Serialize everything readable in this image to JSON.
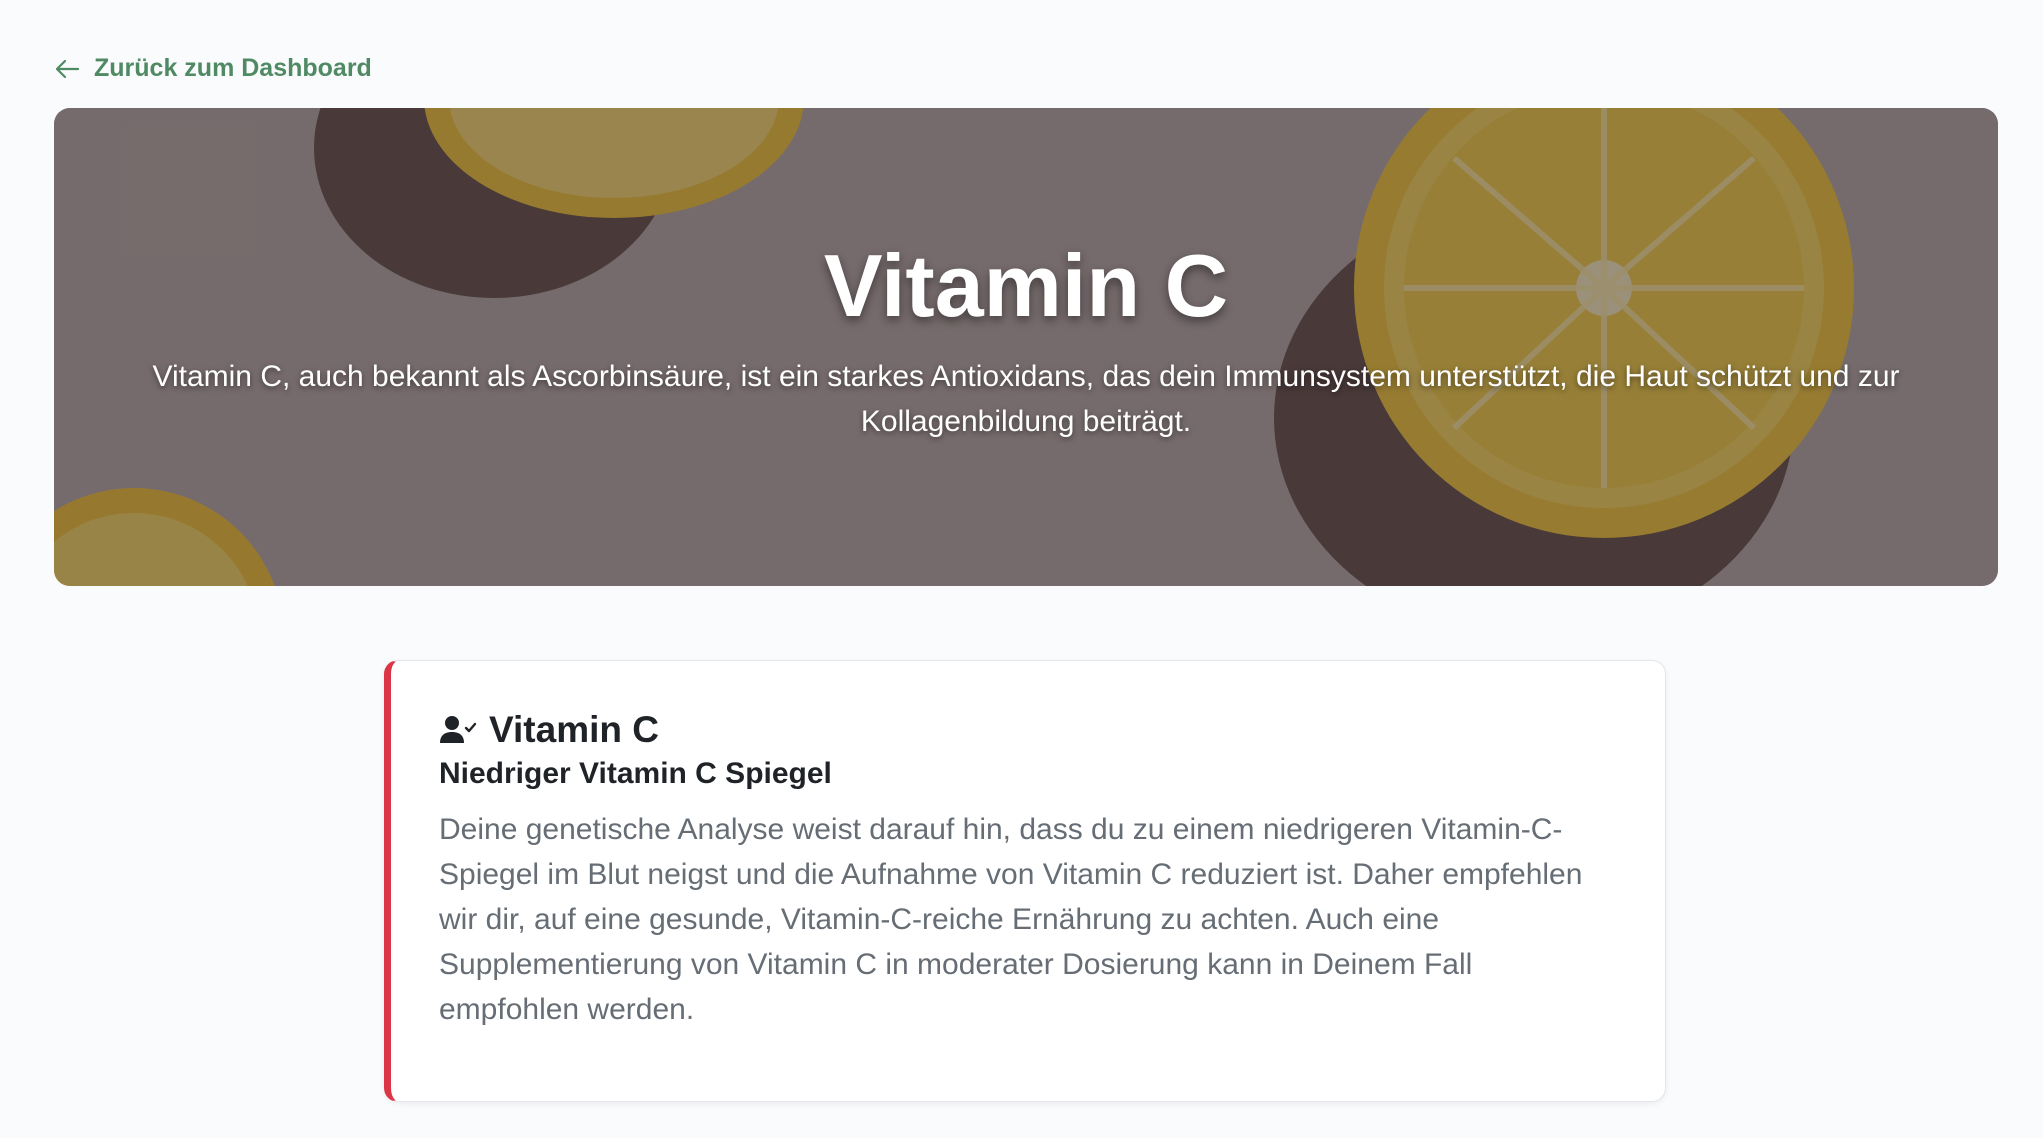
{
  "nav": {
    "back_label": "Zurück zum Dashboard"
  },
  "hero": {
    "title": "Vitamin C",
    "description": "Vitamin C, auch bekannt als Ascorbinsäure, ist ein starkes Antioxidans, das dein Immunsystem unterstützt, die Haut schützt und zur Kollagenbildung beiträgt.",
    "background_image": "halved lemons on pink background"
  },
  "result_card": {
    "icon": "user-check-icon",
    "title": "Vitamin C",
    "subtitle": "Niedriger Vitamin C Spiegel",
    "body": "Deine genetische Analyse weist darauf hin, dass du zu einem niedrigeren Vitamin-C-Spiegel im Blut neigst und die Aufnahme von Vitamin C reduziert ist. Daher empfehlen wir dir, auf eine gesunde, Vitamin-C-reiche Ernährung zu achten. Auch eine Supplementierung von Vitamin C in moderater Dosierung kann in Deinem Fall empfohlen werden.",
    "status_color": "#dc3545"
  },
  "colors": {
    "accent_green": "#4f8a63",
    "status_red": "#dc3545",
    "page_background": "#fafbfd"
  }
}
